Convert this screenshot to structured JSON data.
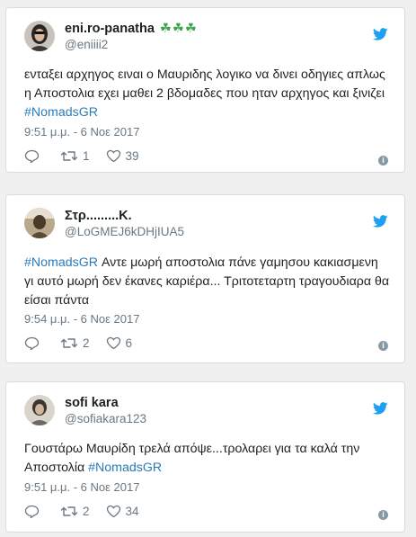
{
  "tweets": [
    {
      "name": "eni.ro-panatha",
      "name_emoji": "☘☘☘",
      "handle": "@eniiii2",
      "text_line1": "ενταξει αρχηγος ειναι ο Μαυριδης λογικο να δινει οδηγιες απλως",
      "text_line2": "η Αποστολια εχει μαθει 2 βδομαδες που ηταν αρχηγος και ξινιζει",
      "hashtag": "#NomadsGR",
      "timestamp": "9:51 μ.μ. - 6 Νοε 2017",
      "retweets": "1",
      "likes": "39"
    },
    {
      "name": "Στρ.........Κ.",
      "handle": "@LoGMEJ6kDHjIUA5",
      "hashtag": "#NomadsGR",
      "text_line1_rest": " Αντε μωρή αποστολια πάνε γαμησου κακιασμενη",
      "text_line2": "γι αυτό μωρή δεν έκανες καριέρα... Τριτοτεταρτη τραγουδιαρα θα",
      "text_line3": "είσαι πάντα",
      "timestamp": "9:54 μ.μ. - 6 Νοε 2017",
      "retweets": "2",
      "likes": "6"
    },
    {
      "name": "sofi kara",
      "handle": "@sofiakara123",
      "text_line1": "Γουστάρω Μαυρίδη τρελά απόψε...τρολαρει για τα καλά την",
      "text_line2_pre": "Αποστολία ",
      "hashtag": "#NomadsGR",
      "timestamp": "9:51 μ.μ. - 6 Νοε 2017",
      "retweets": "2",
      "likes": "34"
    }
  ],
  "colors": {
    "hashtag": "#2b7bb9",
    "twitter_blue": "#1da1f2",
    "muted": "#697882",
    "clover": "#3fa34d"
  },
  "icons": [
    "twitter-bird-icon",
    "reply-icon",
    "retweet-icon",
    "heart-icon",
    "info-icon"
  ]
}
